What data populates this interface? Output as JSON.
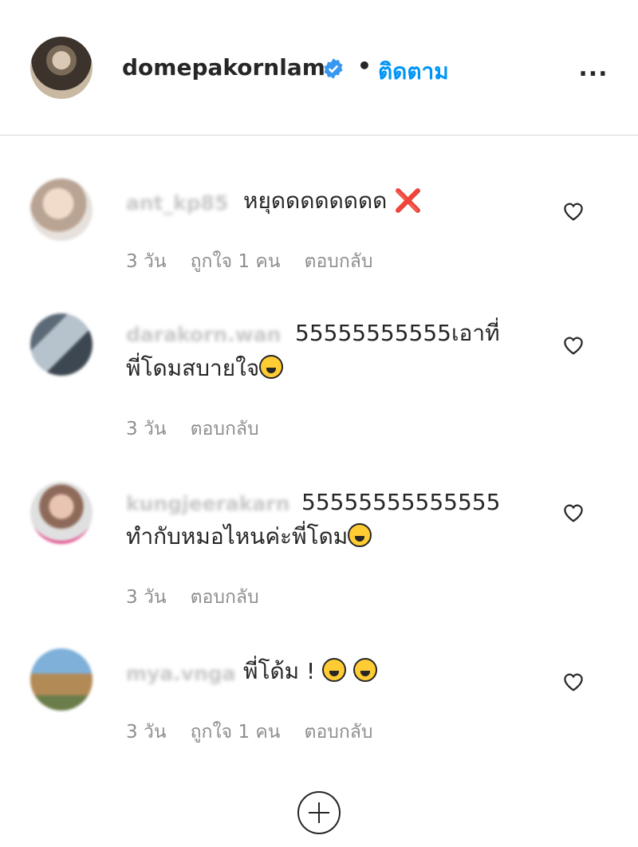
{
  "post_header": {
    "username": "domepakornlam",
    "verified_icon": "verified-badge-icon",
    "separator": "•",
    "follow_label": "ติดตาม",
    "more_label": "...",
    "accent_color": "#0095f6"
  },
  "comments": [
    {
      "username": "ant_kp85",
      "text": "หยุดดดดดดดด ❌",
      "text_line2": "",
      "time": "3 วัน",
      "likes": "ถูกใจ 1 คน",
      "reply": "ตอบกลับ"
    },
    {
      "username": "darakorn.wan",
      "text": "55555555555เอาที่",
      "text_line2": "พี่โดมสบายใจ",
      "time": "3 วัน",
      "likes": "",
      "reply": "ตอบกลับ"
    },
    {
      "username": "kungjeerakarn",
      "text": "55555555555555",
      "text_line2": "ทำกับหมอไหนค่ะพี่โดม",
      "time": "3 วัน",
      "likes": "",
      "reply": "ตอบกลับ"
    },
    {
      "username": "mya.vnga",
      "text": "พี่โด้ม !",
      "text_line2": "",
      "time": "3 วัน",
      "likes": "ถูกใจ 1 คน",
      "reply": "ตอบกลับ"
    }
  ],
  "load_more_icon": "plus-circle-icon"
}
